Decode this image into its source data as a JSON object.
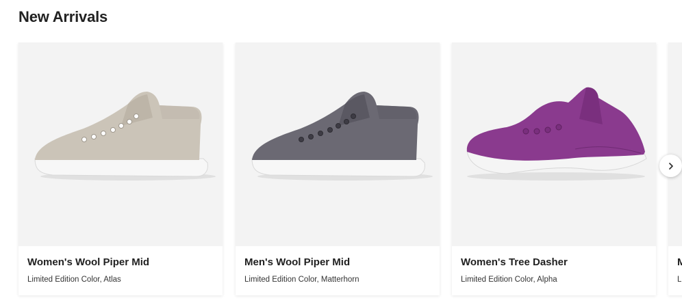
{
  "section": {
    "title": "New Arrivals"
  },
  "products": [
    {
      "name": "Women's Wool Piper Mid",
      "subtitle": "Limited Edition Color, Atlas",
      "color": "#cbc4b8"
    },
    {
      "name": "Men's Wool Piper Mid",
      "subtitle": "Limited Edition Color, Matterhorn",
      "color": "#6b6973"
    },
    {
      "name": "Women's Tree Dasher",
      "subtitle": "Limited Edition Color, Alpha",
      "color": "#8a3a8e"
    },
    {
      "name": "M",
      "subtitle": "L"
    }
  ],
  "carousel": {
    "next_icon": "chevron-right-icon"
  }
}
